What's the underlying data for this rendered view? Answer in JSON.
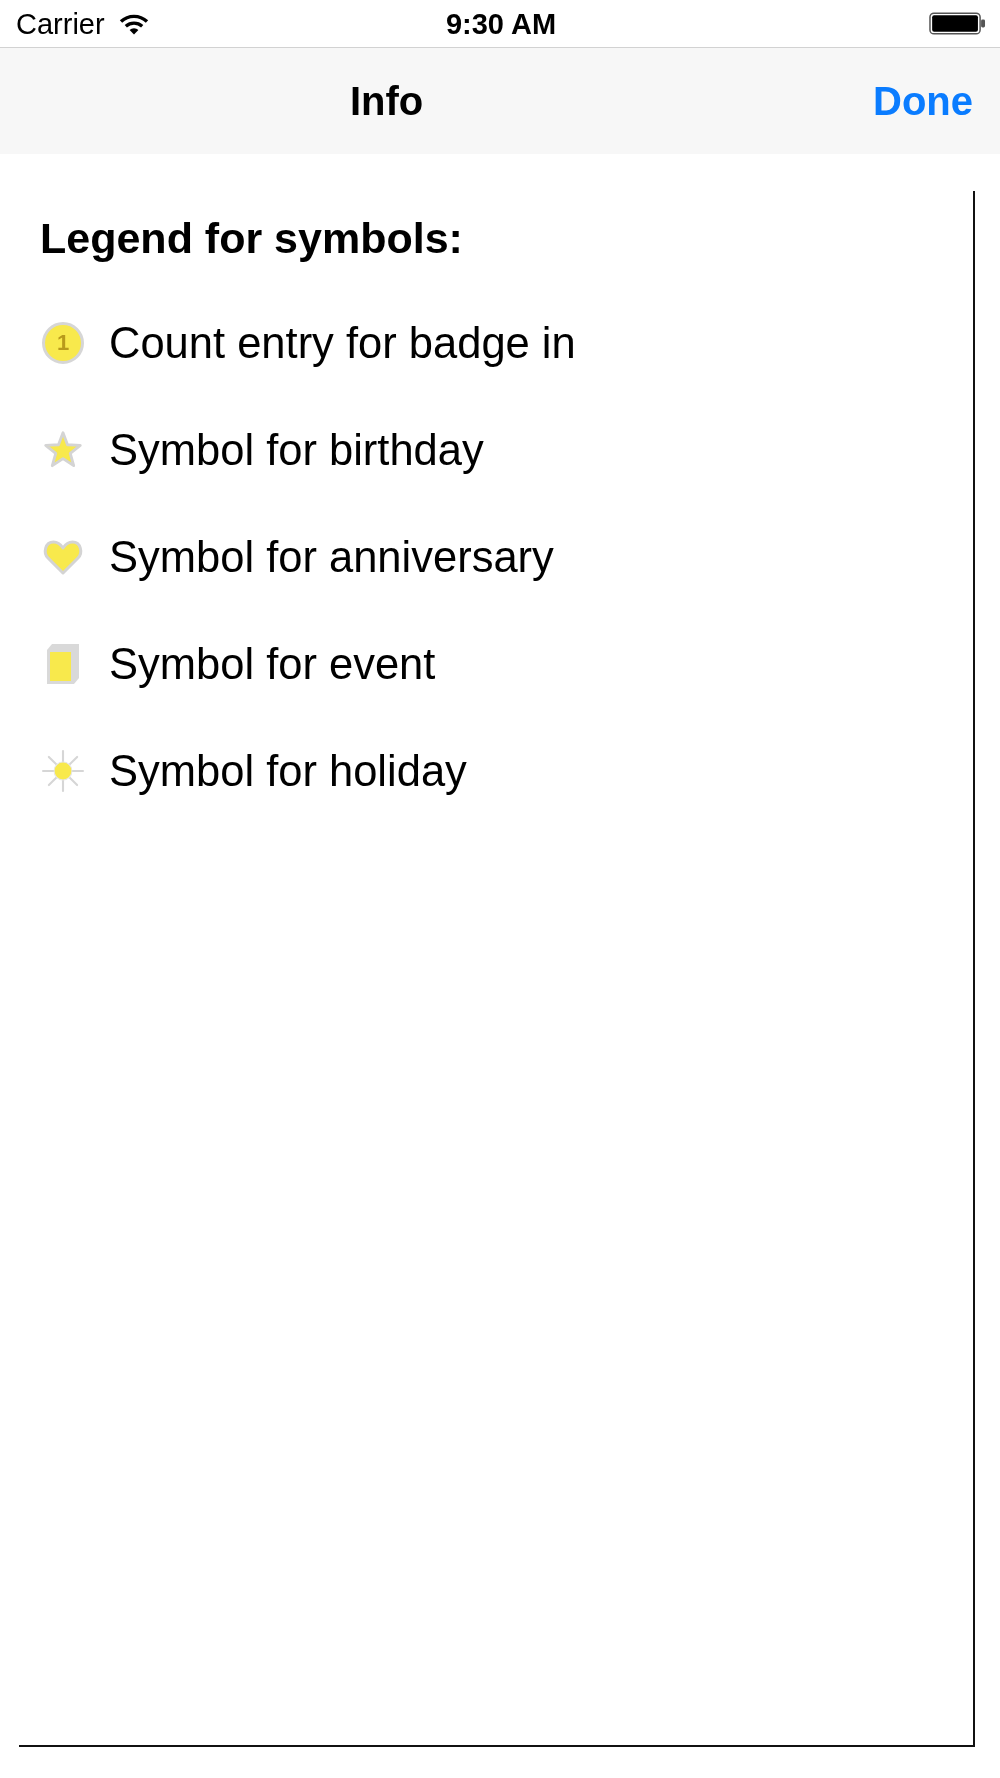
{
  "status_bar": {
    "carrier": "Carrier",
    "time": "9:30 AM"
  },
  "nav_bar": {
    "title": "Info",
    "done_button": "Done"
  },
  "legend": {
    "heading": "Legend for symbols:",
    "items": [
      {
        "kind": "badge",
        "badge_text": "1",
        "label": "Count entry for badge in"
      },
      {
        "kind": "star",
        "label": "Symbol for birthday"
      },
      {
        "kind": "heart",
        "label": "Symbol for anniversary"
      },
      {
        "kind": "event",
        "label": "Symbol for event"
      },
      {
        "kind": "holiday",
        "label": "Symbol for holiday"
      }
    ]
  }
}
